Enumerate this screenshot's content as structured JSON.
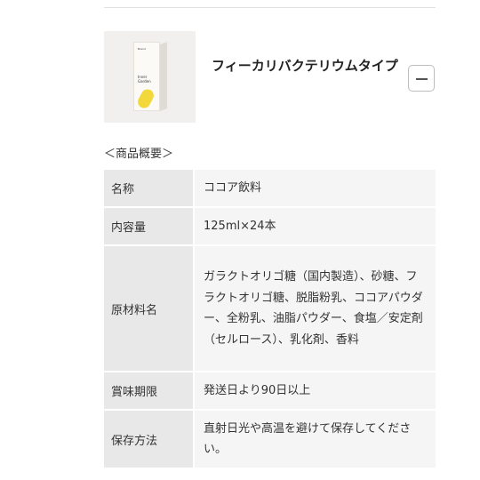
{
  "product": {
    "title": "フィーカリバクテリウムタイプ",
    "image_alt": "Inner Garden",
    "pack_brand": "Brand",
    "pack_name": "Inner Garden",
    "toggle_icon": "minus-icon"
  },
  "overview": {
    "heading": "＜商品概要＞",
    "rows": [
      {
        "label": "名称",
        "value": "ココア飲料"
      },
      {
        "label": "内容量",
        "value": "125ml×24本"
      },
      {
        "label": "原材料名",
        "value": "ガラクトオリゴ糖（国内製造）、砂糖、フラクトオリゴ糖、脱脂粉乳、ココアパウダー、全粉乳、油脂パウダー、食塩／安定剤（セルロース）、乳化剤、香料"
      },
      {
        "label": "賞味期限",
        "value": "発送日より90日以上"
      },
      {
        "label": "保存方法",
        "value": "直射日光や高温を避けて保存してください。"
      }
    ]
  }
}
